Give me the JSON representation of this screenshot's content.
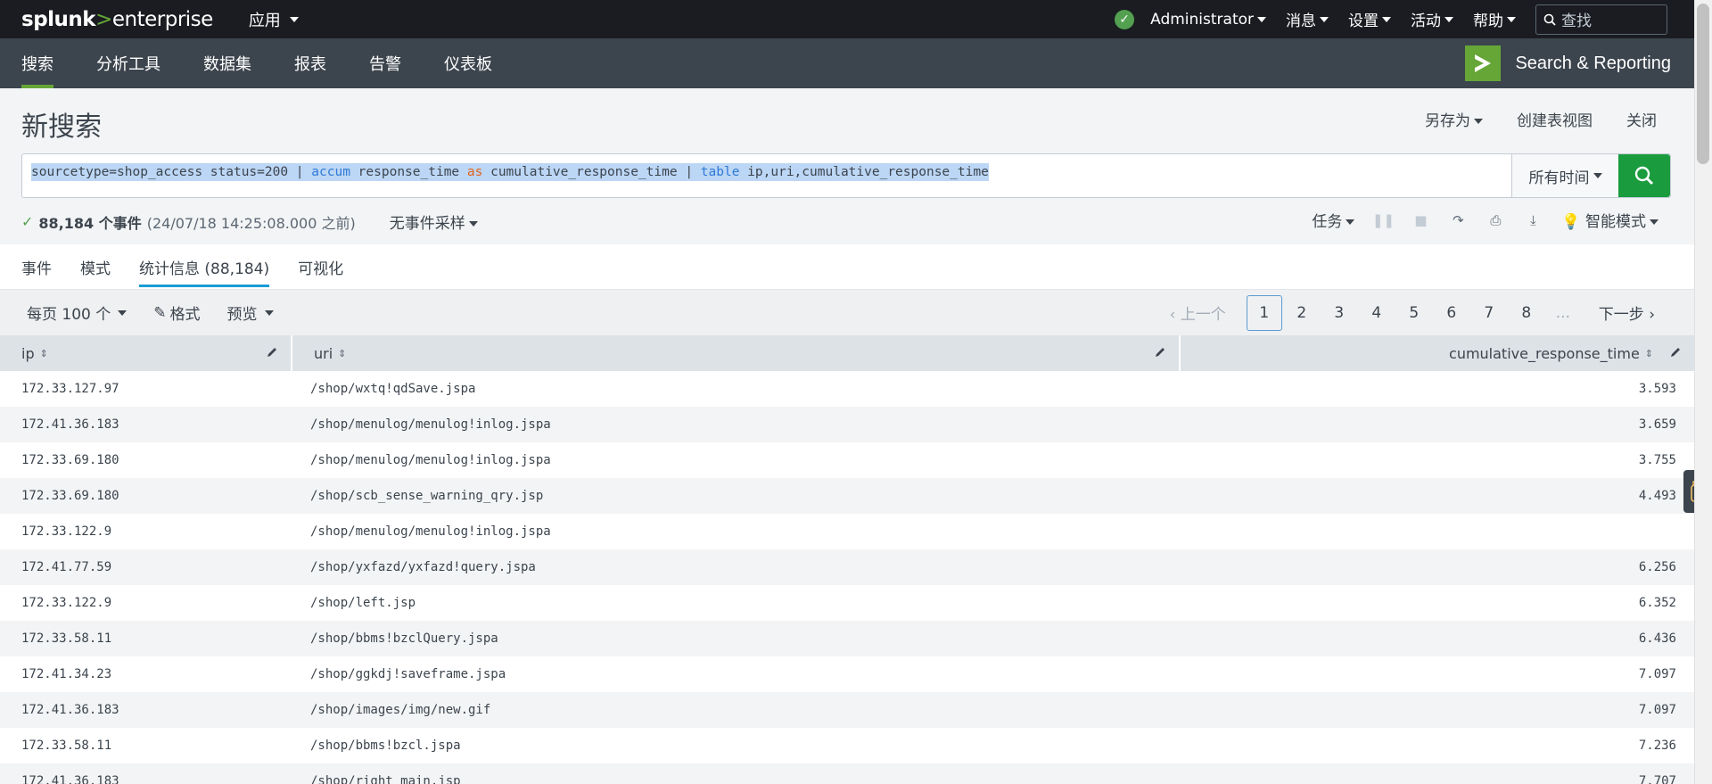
{
  "topbar": {
    "logo": {
      "part1": "splunk",
      "part2": ">",
      "part3": "enterprise"
    },
    "apps_label": "应用",
    "user": "Administrator",
    "messages": "消息",
    "settings": "设置",
    "activity": "活动",
    "help": "帮助",
    "search_placeholder": "查找"
  },
  "navbar": {
    "items": [
      "搜索",
      "分析工具",
      "数据集",
      "报表",
      "告警",
      "仪表板"
    ],
    "app_title": "Search & Reporting"
  },
  "page": {
    "title": "新搜索",
    "actions": {
      "save_as": "另存为",
      "create_table_view": "创建表视图",
      "close": "关闭"
    }
  },
  "search": {
    "q1": "sourcetype=shop_access status=200 | ",
    "q2": "accum",
    "q3": " response_time ",
    "q4": "as",
    "q5": " cumulative_response_time | ",
    "q6": "table",
    "q7": " ip,uri,cumulative_response_time",
    "time_range": "所有时间"
  },
  "status": {
    "count": "88,184 个事件",
    "time": "(24/07/18 14:25:08.000 之前)",
    "sampling": "无事件采样",
    "job": "任务",
    "mode": "智能模式"
  },
  "tabs": [
    "事件",
    "模式",
    "统计信息 (88,184)",
    "可视化"
  ],
  "table_controls": {
    "per_page": "每页 100 个",
    "format": "格式",
    "preview": "预览",
    "prev": "上一个",
    "next": "下一步",
    "pages": [
      "1",
      "2",
      "3",
      "4",
      "5",
      "6",
      "7",
      "8"
    ],
    "ellipsis": "...",
    "current_page": "1"
  },
  "table": {
    "columns": [
      "ip",
      "uri",
      "cumulative_response_time"
    ],
    "rows": [
      {
        "ip": "172.33.127.97",
        "uri": "/shop/wxtq!qdSave.jspa",
        "cum": "3.593"
      },
      {
        "ip": "172.41.36.183",
        "uri": "/shop/menulog/menulog!inlog.jspa",
        "cum": "3.659"
      },
      {
        "ip": "172.33.69.180",
        "uri": "/shop/menulog/menulog!inlog.jspa",
        "cum": "3.755"
      },
      {
        "ip": "172.33.69.180",
        "uri": "/shop/scb_sense_warning_qry.jsp",
        "cum": "4.493"
      },
      {
        "ip": "172.33.122.9",
        "uri": "/shop/menulog/menulog!inlog.jspa",
        "cum": ""
      },
      {
        "ip": "172.41.77.59",
        "uri": "/shop/yxfazd/yxfazd!query.jspa",
        "cum": "6.256"
      },
      {
        "ip": "172.33.122.9",
        "uri": "/shop/left.jsp",
        "cum": "6.352"
      },
      {
        "ip": "172.33.58.11",
        "uri": "/shop/bbms!bzclQuery.jspa",
        "cum": "6.436"
      },
      {
        "ip": "172.41.34.23",
        "uri": "/shop/ggkdj!saveframe.jspa",
        "cum": "7.097"
      },
      {
        "ip": "172.41.36.183",
        "uri": "/shop/images/img/new.gif",
        "cum": "7.097"
      },
      {
        "ip": "172.33.58.11",
        "uri": "/shop/bbms!bzcl.jspa",
        "cum": "7.236"
      },
      {
        "ip": "172.41.36.183",
        "uri": "/shop/right_main.jsp",
        "cum": "7.707"
      }
    ]
  },
  "colors": {
    "brand_green": "#65a637",
    "search_button": "#1a9c3e",
    "topbar_bg": "#1a1c21",
    "navbar_bg": "#3c444d",
    "active_tab": "#1a9bd7"
  }
}
